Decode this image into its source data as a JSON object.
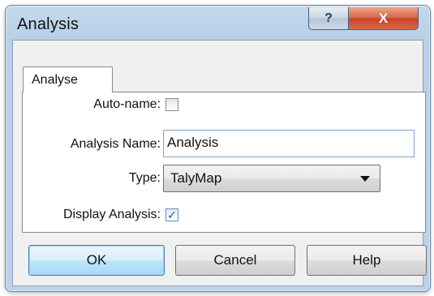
{
  "window": {
    "title": "Analysis",
    "help_glyph": "?",
    "close_glyph": "X"
  },
  "tabs": [
    {
      "label": "Analyse",
      "selected": true
    }
  ],
  "form": {
    "auto_name": {
      "label": "Auto-name:",
      "checked": false
    },
    "analysis_name": {
      "label": "Analysis Name:",
      "value": "Analysis"
    },
    "type": {
      "label": "Type:",
      "selected": "TalyMap"
    },
    "display_analysis": {
      "label": "Display Analysis:",
      "checked": true,
      "check_glyph": "✓"
    }
  },
  "buttons": {
    "ok": "OK",
    "cancel": "Cancel",
    "help": "Help"
  },
  "icons": {
    "help": "help-icon",
    "close": "close-icon",
    "dropdown": "chevron-down-icon",
    "check": "checkmark-icon"
  }
}
